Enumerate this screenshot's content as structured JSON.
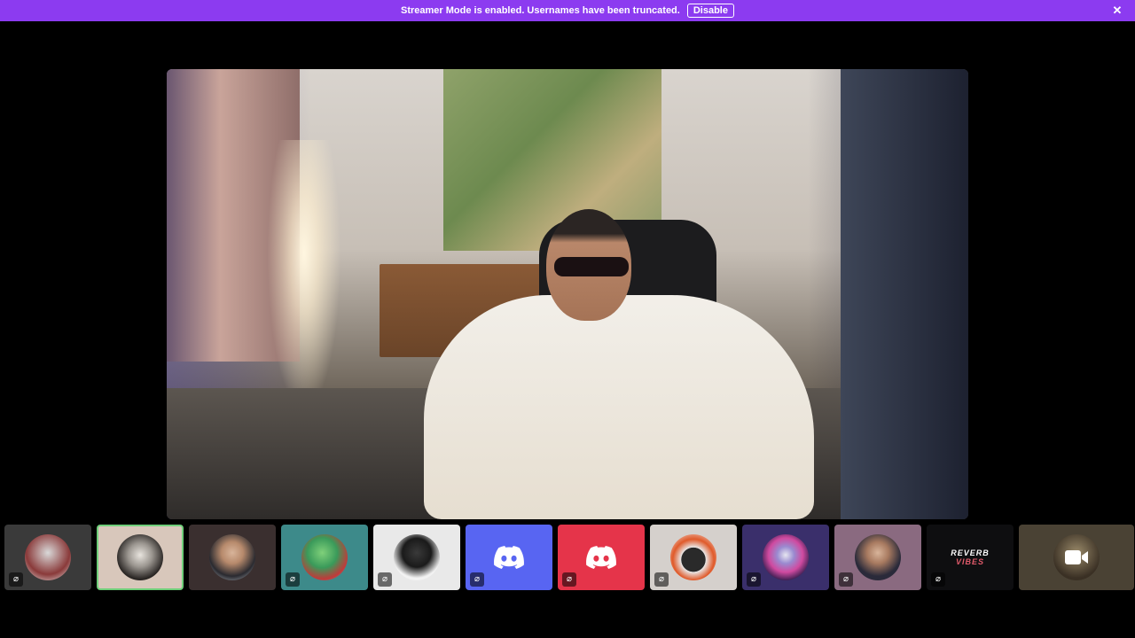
{
  "banner": {
    "message": "Streamer Mode is enabled. Usernames have been truncated.",
    "disable_label": "Disable",
    "background_color": "#8c3bf0"
  },
  "main_video": {
    "description_icon": "video-stream"
  },
  "participants": [
    {
      "muted_icon": "muted-icon",
      "bg": "#3a3a3a"
    },
    {
      "muted_icon": "",
      "bg": "#d8c7bb",
      "selected": true
    },
    {
      "muted_icon": "",
      "bg": "#3a2f2f"
    },
    {
      "muted_icon": "muted-icon",
      "bg": "#3d8a8a"
    },
    {
      "muted_icon": "muted-icon",
      "bg": "#e9e9e9"
    },
    {
      "muted_icon": "muted-icon",
      "bg": "#5865f2"
    },
    {
      "muted_icon": "muted-icon",
      "bg": "#e5344a"
    },
    {
      "muted_icon": "muted-icon",
      "bg": "#d5d0cc"
    },
    {
      "muted_icon": "muted-icon",
      "bg": "#3a2f6b"
    },
    {
      "muted_icon": "muted-icon",
      "bg": "#8a6a80"
    },
    {
      "muted_icon": "muted-icon",
      "bg": "#0e0e10",
      "label": "REVERB VIBES"
    },
    {
      "muted_icon": "",
      "bg": "#4a4234",
      "camera_icon": "camera-icon"
    }
  ],
  "colors": {
    "selected_border": "#6fcf7a",
    "discord_blurple": "#5865f2",
    "discord_red": "#e5344a"
  }
}
